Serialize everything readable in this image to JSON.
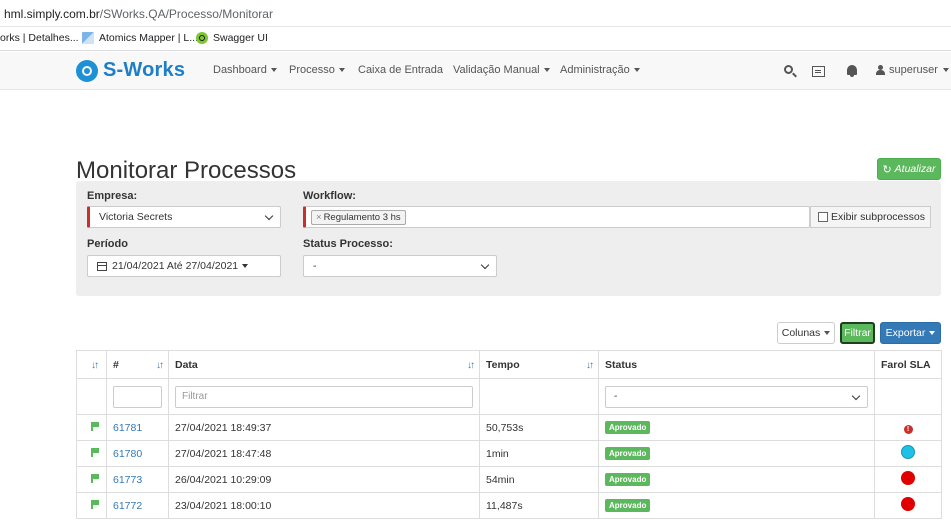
{
  "browser": {
    "url_host": "hml.simply.com.br",
    "url_path": "/SWorks.QA/Processo/Monitorar",
    "bookmarks": [
      {
        "label": "orks | Detalhes..."
      },
      {
        "label": "Atomics Mapper | L..."
      },
      {
        "label": "Swagger UI"
      }
    ]
  },
  "navbar": {
    "brand": "S-Works",
    "items": [
      {
        "label": "Dashboard",
        "dropdown": true
      },
      {
        "label": "Processo",
        "dropdown": true
      },
      {
        "label": "Caixa de Entrada",
        "dropdown": false
      },
      {
        "label": "Validação Manual",
        "dropdown": true
      },
      {
        "label": "Administração",
        "dropdown": true
      }
    ],
    "user": "superuser",
    "brand_color": "#1e7ec8"
  },
  "page": {
    "title": "Monitorar Processos",
    "refresh_label": "Atualizar"
  },
  "filters": {
    "empresa_label": "Empresa:",
    "empresa_value": "Victoria Secrets",
    "workflow_label": "Workflow:",
    "workflow_tag": "Regulamento 3 hs",
    "subprocess_label": "Exibir subprocessos",
    "periodo_label": "Período",
    "periodo_value": "21/04/2021 Até 27/04/2021",
    "status_label": "Status Processo:",
    "status_value": "-"
  },
  "toolbar": {
    "columns_label": "Colunas",
    "filter_label": "Filtrar",
    "export_label": "Exportar"
  },
  "table": {
    "headers": {
      "id": "#",
      "date": "Data",
      "time": "Tempo",
      "status": "Status",
      "sla": "Farol SLA"
    },
    "filter_placeholder": "Filtrar",
    "status_filter_value": "-",
    "rows": [
      {
        "id": "61781",
        "date": "27/04/2021 18:49:37",
        "time": "50,753s",
        "status": "Aprovado",
        "sla": "alert",
        "sla_color": "#c9302c"
      },
      {
        "id": "61780",
        "date": "27/04/2021 18:47:48",
        "time": "1min",
        "status": "Aprovado",
        "sla": "dot",
        "sla_color": "#1ec0e6"
      },
      {
        "id": "61773",
        "date": "26/04/2021 10:29:09",
        "time": "54min",
        "status": "Aprovado",
        "sla": "dot",
        "sla_color": "#e00000"
      },
      {
        "id": "61772",
        "date": "23/04/2021 18:00:10",
        "time": "11,487s",
        "status": "Aprovado",
        "sla": "dot",
        "sla_color": "#e00000"
      }
    ]
  }
}
